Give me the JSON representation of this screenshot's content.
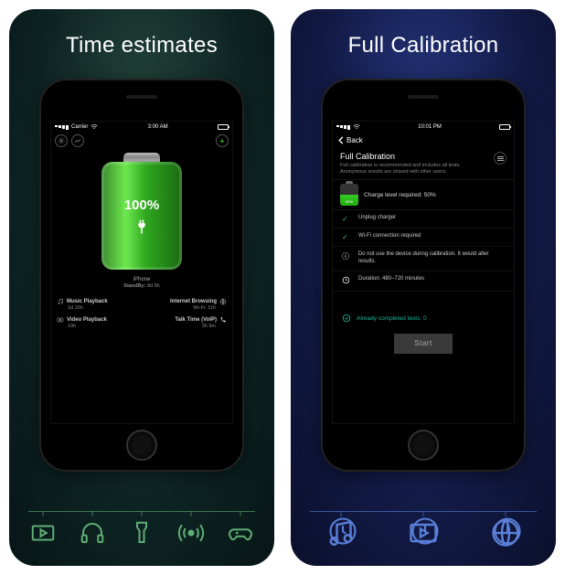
{
  "left": {
    "title": "Time estimates",
    "statusbar": {
      "carrier": "Carrier",
      "time": "3:00 AM"
    },
    "battery_percent": "100%",
    "model": "iPhone",
    "standby_label": "StandBy:",
    "standby_value": "8d 8h",
    "estimates": {
      "music": {
        "label": "Music Playback",
        "value": "1d 16h"
      },
      "browse": {
        "label": "Internet Browsing",
        "sub": "Wi-Fi: 11h"
      },
      "video": {
        "label": "Video Playback",
        "value": "10h"
      },
      "voip": {
        "label": "Talk Time (VoIP)",
        "value": "3h 9m"
      }
    },
    "rail_icons": [
      "video",
      "headphones",
      "flashlight",
      "hotspot",
      "gamepad"
    ]
  },
  "right": {
    "title": "Full Calibration",
    "statusbar": {
      "time": "10:01 PM"
    },
    "back": "Back",
    "header": "Full Calibration",
    "subheader": "Full calibration is recommended and includes all tests. Anonymous results are shared with other users.",
    "charge_required": "Charge level required: 50%",
    "charge_badge": "50%",
    "steps": {
      "unplug": "Unplug charger",
      "wifi": "Wi-Fi connection required",
      "nouse": "Do not use the device during calibration. It would alter results.",
      "duration": "Duration: 480–720 minutes"
    },
    "already": "Already completed tests: 0",
    "start": "Start",
    "rail_icons": [
      "music",
      "video",
      "globe"
    ]
  }
}
